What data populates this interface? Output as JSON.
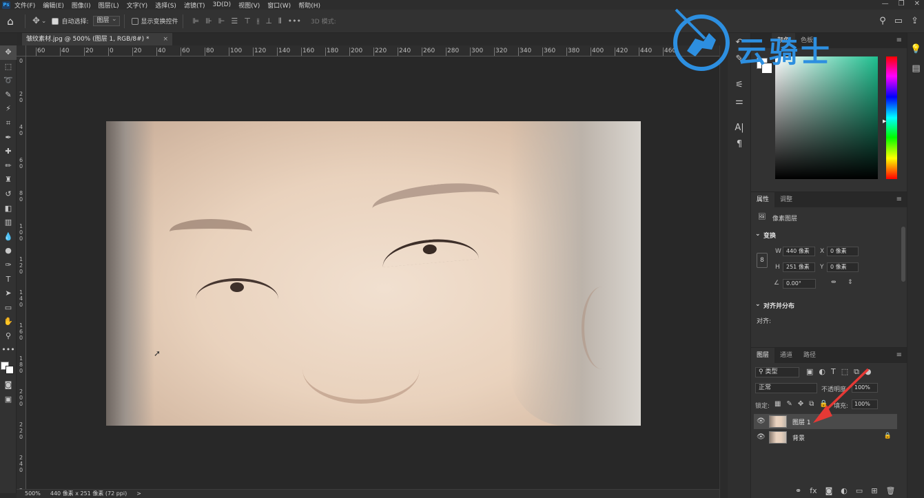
{
  "menubar": {
    "app_icon": "Ps",
    "items": [
      "文件(F)",
      "编辑(E)",
      "图像(I)",
      "图层(L)",
      "文字(Y)",
      "选择(S)",
      "滤镜(T)",
      "3D(D)",
      "视图(V)",
      "窗口(W)",
      "帮助(H)"
    ]
  },
  "optionsbar": {
    "auto_select_label": "自动选择:",
    "auto_select_value": "图层",
    "show_transform_label": "显示变换控件",
    "mode_3d_label": "3D 模式:"
  },
  "document": {
    "tab_title": "皱纹素材.jpg @ 500% (图层 1, RGB/8#) *",
    "close_glyph": "×"
  },
  "ruler_top": {
    "ticks": [
      "60",
      "40",
      "20",
      "0",
      "20",
      "40",
      "60",
      "80",
      "100",
      "120",
      "140",
      "160",
      "180",
      "200",
      "220",
      "240",
      "260",
      "280",
      "300",
      "320",
      "340",
      "360",
      "380",
      "400",
      "420",
      "440",
      "460"
    ]
  },
  "ruler_left": {
    "ticks": [
      "0",
      "2 0",
      "4 0",
      "6 0",
      "8 0",
      "1 0 0",
      "1 2 0",
      "1 4 0",
      "1 6 0",
      "1 8 0",
      "2 0 0",
      "2 2 0",
      "2 4 0",
      "2 6 0"
    ]
  },
  "statusbar": {
    "zoom": "500%",
    "info": "440 像素 x 251 像素 (72 ppi)",
    "chevron": ">"
  },
  "color_panel": {
    "tabs": [
      "颜色",
      "色板"
    ]
  },
  "properties": {
    "tabs": [
      "属性",
      "调整"
    ],
    "pixel_layer_label": "像素图层",
    "transform_label": "变换",
    "w_label": "W",
    "w_value": "440 像素",
    "h_label": "H",
    "h_value": "251 像素",
    "x_label": "X",
    "x_value": "0 像素",
    "y_label": "Y",
    "y_value": "0 像素",
    "angle_value": "0.00°",
    "align_section_label": "对齐并分布",
    "align_label": "对齐:"
  },
  "layers": {
    "tabs": [
      "图层",
      "通道",
      "路径"
    ],
    "filter_kind": "类型",
    "blend_mode": "正常",
    "opacity_label": "不透明度:",
    "opacity_value": "100%",
    "lock_label": "锁定:",
    "fill_label": "填充:",
    "fill_value": "100%",
    "items": [
      {
        "name": "图层 1",
        "selected": true
      },
      {
        "name": "背景",
        "selected": false,
        "locked": true
      }
    ]
  },
  "watermark": {
    "text": "云骑士",
    "color": "#2d8fe0"
  },
  "colors": {
    "accent_blue": "#2d8fe0",
    "annotation_red": "#e53935",
    "panel_bg": "#323232",
    "canvas_bg": "#282828"
  }
}
